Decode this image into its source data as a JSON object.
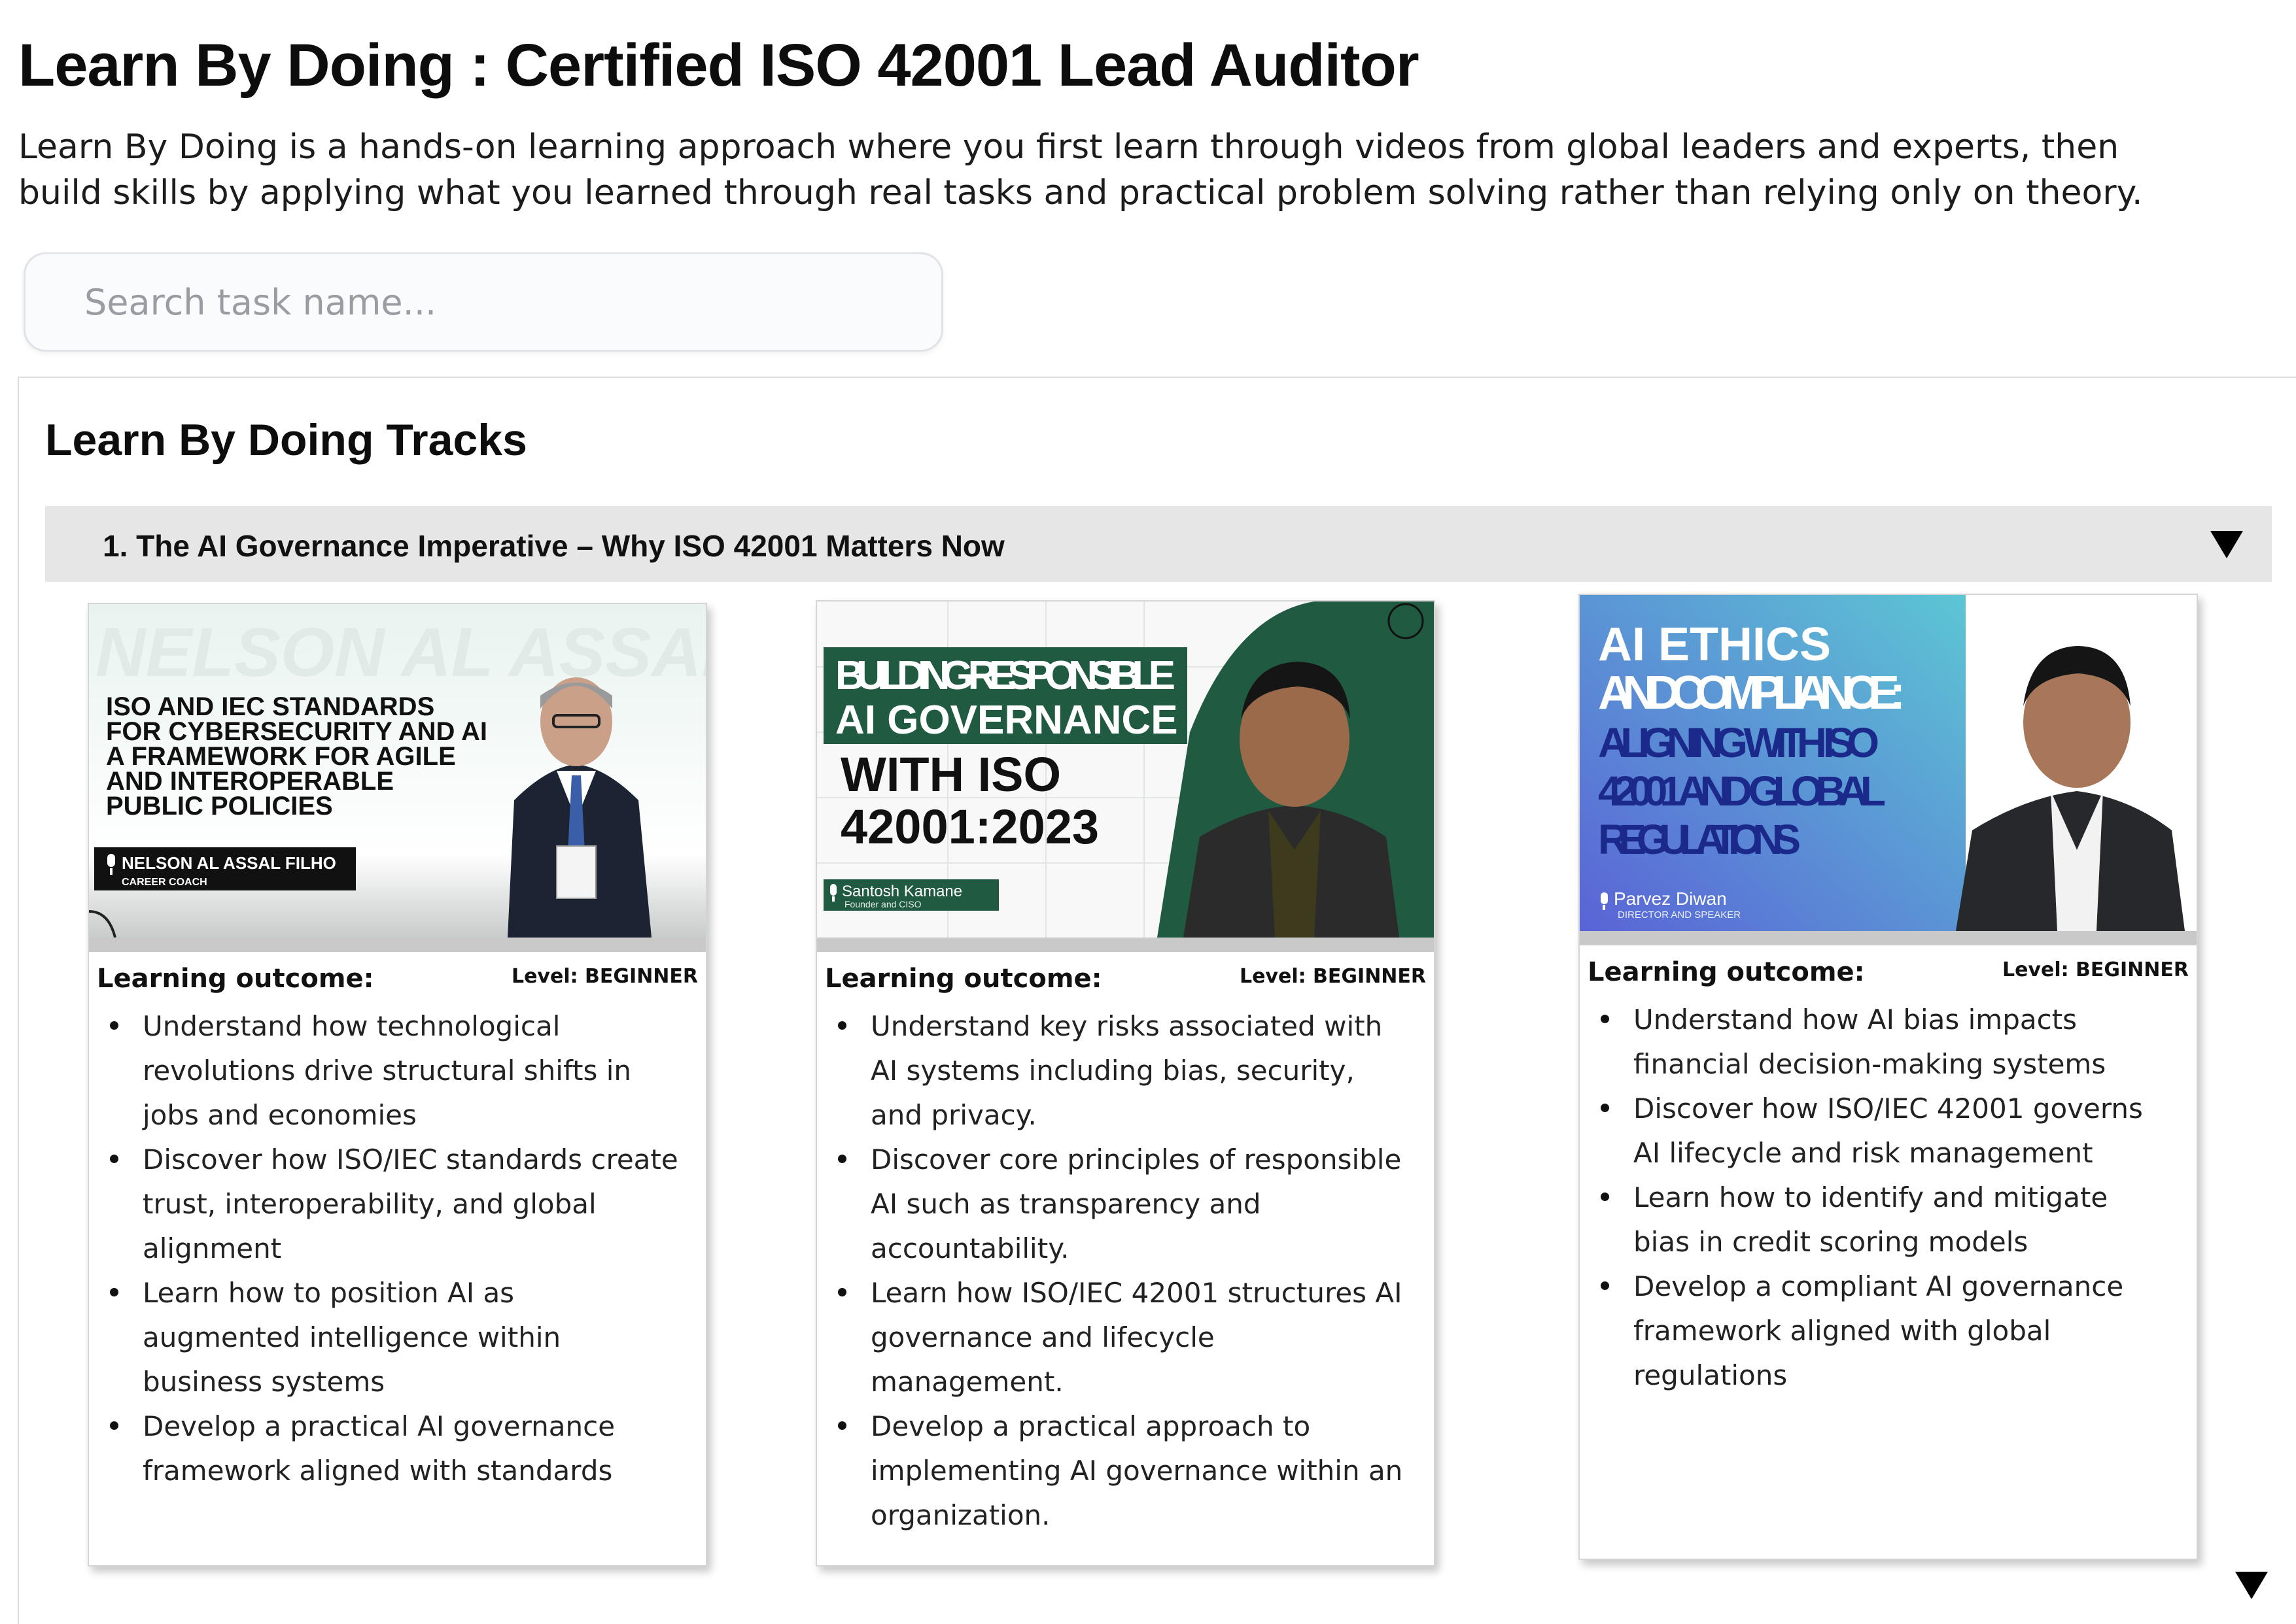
{
  "page": {
    "title": "Learn By Doing : Certified ISO 42001 Lead Auditor",
    "description": "Learn By Doing is a hands-on learning approach where you first learn through videos from global leaders and experts, then build skills by applying what you learned through real tasks and practical problem solving rather than relying only on theory."
  },
  "search": {
    "placeholder": "Search task name...",
    "value": ""
  },
  "tracks": {
    "title": "Learn By Doing Tracks",
    "sections": [
      {
        "title": "1. The AI Governance Imperative – Why ISO 42001 Matters Now",
        "expanded": true,
        "cards": [
          {
            "thumbnail": {
              "watermark": "NELSON AL ASSAL FILHO",
              "headline": [
                "ISO AND IEC STANDARDS",
                "FOR CYBERSECURITY AND AI",
                "A FRAMEWORK FOR AGILE",
                "AND INTEROPERABLE",
                "PUBLIC POLICIES"
              ],
              "speaker_name": "NELSON AL ASSAL FILHO",
              "speaker_role": "CAREER COACH",
              "colors": {
                "background": "#eef4f1",
                "text": "#111111",
                "name_box": "#111111"
              }
            },
            "learning_outcome_label": "Learning outcome:",
            "level": "Level: BEGINNER",
            "outcomes": [
              "Understand how technological revolutions drive structural shifts in jobs and economies",
              "Discover how ISO/IEC standards create trust, interoperability, and global alignment",
              "Learn how to position AI as augmented intelligence within business systems",
              "Develop a practical AI governance framework aligned with standards"
            ]
          },
          {
            "thumbnail": {
              "headline_box": [
                "BUILDING RESPONSIBLE",
                "AI GOVERNANCE"
              ],
              "headline": [
                "WITH ISO",
                "42001:2023"
              ],
              "speaker_name": "Santosh Kamane",
              "speaker_role": "Founder and CISO",
              "colors": {
                "background": "#f7f8f7",
                "accent": "#1f5a41",
                "text": "#111111"
              }
            },
            "learning_outcome_label": "Learning outcome:",
            "level": "Level: BEGINNER",
            "outcomes": [
              "Understand key risks associated with AI systems including bias, security, and privacy.",
              "Discover core principles of responsible AI such as transparency and accountability.",
              "Learn how ISO/IEC 42001 structures AI governance and lifecycle management.",
              "Develop a practical approach to implementing AI governance within an organization."
            ]
          },
          {
            "thumbnail": {
              "headline_white": [
                "AI ETHICS",
                "ANDCOMPLIANCE:"
              ],
              "headline": [
                "ALIGNING WITH ISO",
                "42001 AND GLOBAL",
                "REGULATIONS"
              ],
              "speaker_name": "Parvez Diwan",
              "speaker_role": "DIRECTOR AND SPEAKER",
              "colors": {
                "gradient_start": "#5a63d6",
                "gradient_end": "#5cc6d4",
                "text": "#1b2a8a"
              }
            },
            "learning_outcome_label": "Learning outcome:",
            "level": "Level: BEGINNER",
            "outcomes": [
              "Understand how AI bias impacts financial decision-making systems",
              "Discover how ISO/IEC 42001 governs AI lifecycle and risk management",
              "Learn how to identify and mitigate bias in credit scoring models",
              "Develop a compliant AI governance framework aligned with global regulations"
            ]
          }
        ]
      }
    ]
  },
  "icons": {
    "accordion_toggle": "triangle-down-icon",
    "scroll_down": "triangle-down-icon",
    "microphone": "microphone-icon"
  }
}
